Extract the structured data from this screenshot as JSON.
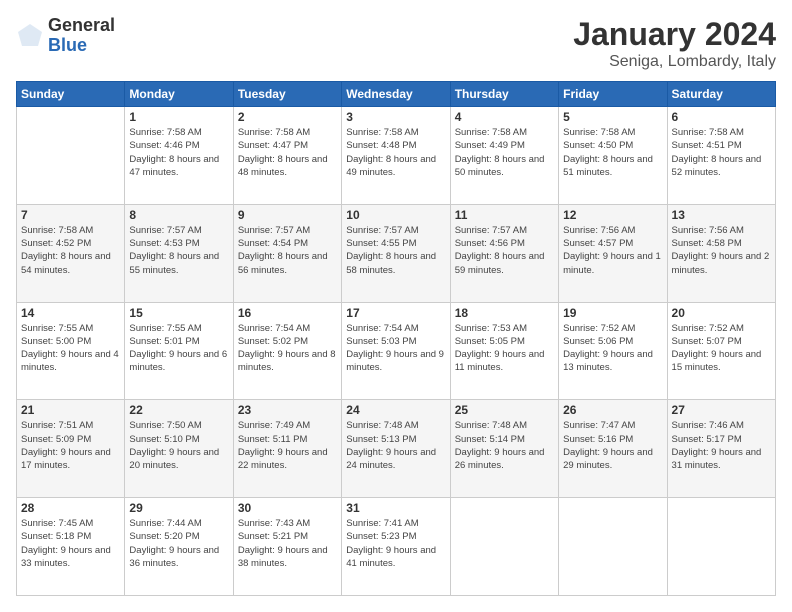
{
  "logo": {
    "general": "General",
    "blue": "Blue"
  },
  "header": {
    "month": "January 2024",
    "location": "Seniga, Lombardy, Italy"
  },
  "weekdays": [
    "Sunday",
    "Monday",
    "Tuesday",
    "Wednesday",
    "Thursday",
    "Friday",
    "Saturday"
  ],
  "weeks": [
    [
      {
        "day": "",
        "sunrise": "",
        "sunset": "",
        "daylight": ""
      },
      {
        "day": "1",
        "sunrise": "Sunrise: 7:58 AM",
        "sunset": "Sunset: 4:46 PM",
        "daylight": "Daylight: 8 hours and 47 minutes."
      },
      {
        "day": "2",
        "sunrise": "Sunrise: 7:58 AM",
        "sunset": "Sunset: 4:47 PM",
        "daylight": "Daylight: 8 hours and 48 minutes."
      },
      {
        "day": "3",
        "sunrise": "Sunrise: 7:58 AM",
        "sunset": "Sunset: 4:48 PM",
        "daylight": "Daylight: 8 hours and 49 minutes."
      },
      {
        "day": "4",
        "sunrise": "Sunrise: 7:58 AM",
        "sunset": "Sunset: 4:49 PM",
        "daylight": "Daylight: 8 hours and 50 minutes."
      },
      {
        "day": "5",
        "sunrise": "Sunrise: 7:58 AM",
        "sunset": "Sunset: 4:50 PM",
        "daylight": "Daylight: 8 hours and 51 minutes."
      },
      {
        "day": "6",
        "sunrise": "Sunrise: 7:58 AM",
        "sunset": "Sunset: 4:51 PM",
        "daylight": "Daylight: 8 hours and 52 minutes."
      }
    ],
    [
      {
        "day": "7",
        "sunrise": "Sunrise: 7:58 AM",
        "sunset": "Sunset: 4:52 PM",
        "daylight": "Daylight: 8 hours and 54 minutes."
      },
      {
        "day": "8",
        "sunrise": "Sunrise: 7:57 AM",
        "sunset": "Sunset: 4:53 PM",
        "daylight": "Daylight: 8 hours and 55 minutes."
      },
      {
        "day": "9",
        "sunrise": "Sunrise: 7:57 AM",
        "sunset": "Sunset: 4:54 PM",
        "daylight": "Daylight: 8 hours and 56 minutes."
      },
      {
        "day": "10",
        "sunrise": "Sunrise: 7:57 AM",
        "sunset": "Sunset: 4:55 PM",
        "daylight": "Daylight: 8 hours and 58 minutes."
      },
      {
        "day": "11",
        "sunrise": "Sunrise: 7:57 AM",
        "sunset": "Sunset: 4:56 PM",
        "daylight": "Daylight: 8 hours and 59 minutes."
      },
      {
        "day": "12",
        "sunrise": "Sunrise: 7:56 AM",
        "sunset": "Sunset: 4:57 PM",
        "daylight": "Daylight: 9 hours and 1 minute."
      },
      {
        "day": "13",
        "sunrise": "Sunrise: 7:56 AM",
        "sunset": "Sunset: 4:58 PM",
        "daylight": "Daylight: 9 hours and 2 minutes."
      }
    ],
    [
      {
        "day": "14",
        "sunrise": "Sunrise: 7:55 AM",
        "sunset": "Sunset: 5:00 PM",
        "daylight": "Daylight: 9 hours and 4 minutes."
      },
      {
        "day": "15",
        "sunrise": "Sunrise: 7:55 AM",
        "sunset": "Sunset: 5:01 PM",
        "daylight": "Daylight: 9 hours and 6 minutes."
      },
      {
        "day": "16",
        "sunrise": "Sunrise: 7:54 AM",
        "sunset": "Sunset: 5:02 PM",
        "daylight": "Daylight: 9 hours and 8 minutes."
      },
      {
        "day": "17",
        "sunrise": "Sunrise: 7:54 AM",
        "sunset": "Sunset: 5:03 PM",
        "daylight": "Daylight: 9 hours and 9 minutes."
      },
      {
        "day": "18",
        "sunrise": "Sunrise: 7:53 AM",
        "sunset": "Sunset: 5:05 PM",
        "daylight": "Daylight: 9 hours and 11 minutes."
      },
      {
        "day": "19",
        "sunrise": "Sunrise: 7:52 AM",
        "sunset": "Sunset: 5:06 PM",
        "daylight": "Daylight: 9 hours and 13 minutes."
      },
      {
        "day": "20",
        "sunrise": "Sunrise: 7:52 AM",
        "sunset": "Sunset: 5:07 PM",
        "daylight": "Daylight: 9 hours and 15 minutes."
      }
    ],
    [
      {
        "day": "21",
        "sunrise": "Sunrise: 7:51 AM",
        "sunset": "Sunset: 5:09 PM",
        "daylight": "Daylight: 9 hours and 17 minutes."
      },
      {
        "day": "22",
        "sunrise": "Sunrise: 7:50 AM",
        "sunset": "Sunset: 5:10 PM",
        "daylight": "Daylight: 9 hours and 20 minutes."
      },
      {
        "day": "23",
        "sunrise": "Sunrise: 7:49 AM",
        "sunset": "Sunset: 5:11 PM",
        "daylight": "Daylight: 9 hours and 22 minutes."
      },
      {
        "day": "24",
        "sunrise": "Sunrise: 7:48 AM",
        "sunset": "Sunset: 5:13 PM",
        "daylight": "Daylight: 9 hours and 24 minutes."
      },
      {
        "day": "25",
        "sunrise": "Sunrise: 7:48 AM",
        "sunset": "Sunset: 5:14 PM",
        "daylight": "Daylight: 9 hours and 26 minutes."
      },
      {
        "day": "26",
        "sunrise": "Sunrise: 7:47 AM",
        "sunset": "Sunset: 5:16 PM",
        "daylight": "Daylight: 9 hours and 29 minutes."
      },
      {
        "day": "27",
        "sunrise": "Sunrise: 7:46 AM",
        "sunset": "Sunset: 5:17 PM",
        "daylight": "Daylight: 9 hours and 31 minutes."
      }
    ],
    [
      {
        "day": "28",
        "sunrise": "Sunrise: 7:45 AM",
        "sunset": "Sunset: 5:18 PM",
        "daylight": "Daylight: 9 hours and 33 minutes."
      },
      {
        "day": "29",
        "sunrise": "Sunrise: 7:44 AM",
        "sunset": "Sunset: 5:20 PM",
        "daylight": "Daylight: 9 hours and 36 minutes."
      },
      {
        "day": "30",
        "sunrise": "Sunrise: 7:43 AM",
        "sunset": "Sunset: 5:21 PM",
        "daylight": "Daylight: 9 hours and 38 minutes."
      },
      {
        "day": "31",
        "sunrise": "Sunrise: 7:41 AM",
        "sunset": "Sunset: 5:23 PM",
        "daylight": "Daylight: 9 hours and 41 minutes."
      },
      {
        "day": "",
        "sunrise": "",
        "sunset": "",
        "daylight": ""
      },
      {
        "day": "",
        "sunrise": "",
        "sunset": "",
        "daylight": ""
      },
      {
        "day": "",
        "sunrise": "",
        "sunset": "",
        "daylight": ""
      }
    ]
  ]
}
